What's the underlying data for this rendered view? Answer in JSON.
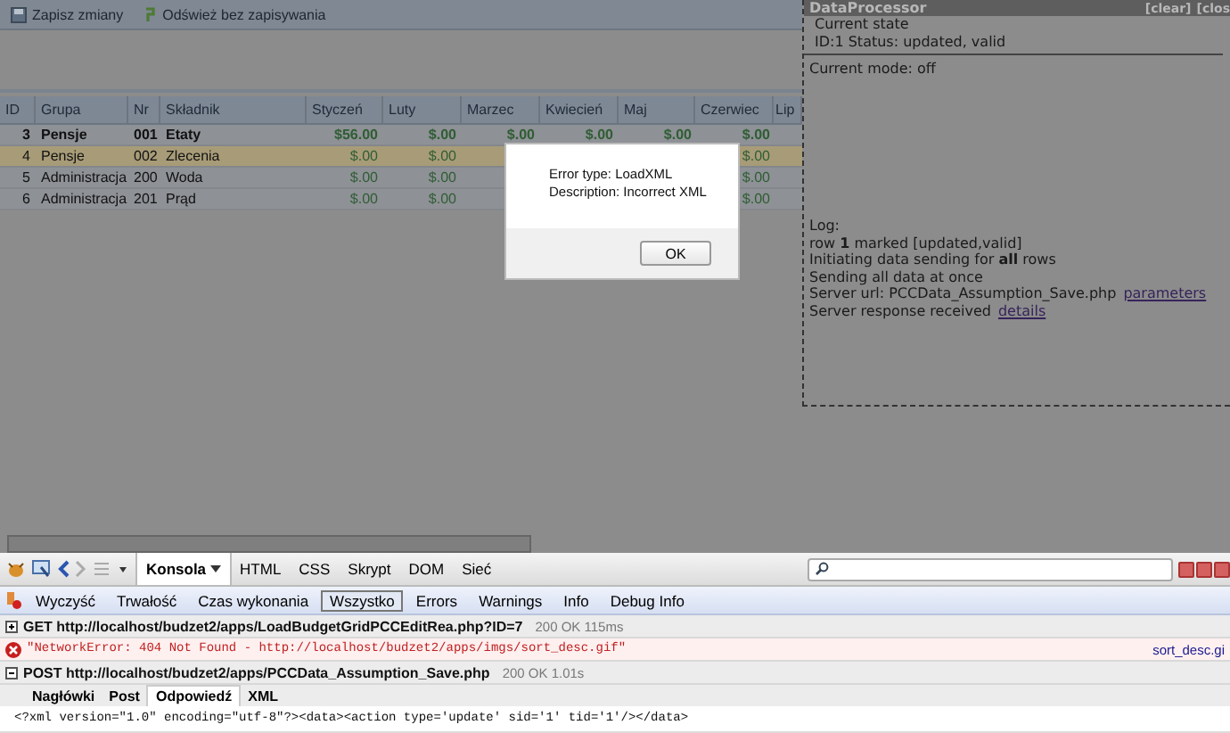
{
  "toolbar": [
    {
      "kind": "save",
      "label": "Zapisz zmiany"
    },
    {
      "kind": "refresh",
      "label": "Odśwież bez zapisywania"
    }
  ],
  "grid": {
    "columns": [
      "ID",
      "Grupa",
      "Nr",
      "Składnik",
      "Styczeń",
      "Luty",
      "Marzec",
      "Kwiecień",
      "Maj",
      "Czerwiec",
      "Lip"
    ],
    "rows": [
      {
        "id": "3",
        "group": "Pensje",
        "nr": "001",
        "name": "Etaty",
        "values": [
          "$56.00",
          "$.00",
          "$.00",
          "$.00",
          "$.00",
          "$.00"
        ],
        "updated": true,
        "selected": false
      },
      {
        "id": "4",
        "group": "Pensje",
        "nr": "002",
        "name": "Zlecenia",
        "values": [
          "$.00",
          "$.00",
          "$.00"
        ],
        "updated": false,
        "selected": true
      },
      {
        "id": "5",
        "group": "Administracja",
        "nr": "200",
        "name": "Woda",
        "values": [
          "$.00",
          "$.00",
          "$.00"
        ],
        "updated": false,
        "selected": false
      },
      {
        "id": "6",
        "group": "Administracja",
        "nr": "201",
        "name": "Prąd",
        "values": [
          "$.00",
          "$.00",
          "$.00"
        ],
        "updated": false,
        "selected": false
      }
    ]
  },
  "dialog": {
    "lines": [
      "Error type: LoadXML",
      "Description: Incorrect XML"
    ],
    "button": "OK"
  },
  "data_processor": {
    "title": "DataProcessor",
    "actions": [
      "[clear]",
      "[clos"
    ],
    "state_lines": [
      "Current state",
      "ID:1 Status: updated, valid"
    ],
    "mode": "Current mode: off",
    "log": [
      {
        "text": "Log:"
      },
      {
        "text": "row **1** marked [updated,valid]"
      },
      {
        "text": "Initiating data sending for **all** rows"
      },
      {
        "text": "Sending all data at once"
      },
      {
        "text": "Server url: PCCData_Assumption_Save.php",
        "link": "parameters"
      },
      {
        "text": "Server response received",
        "link": "details"
      }
    ]
  },
  "firebug": {
    "panels": [
      {
        "label": "Konsola",
        "selected": true
      },
      {
        "label": "HTML",
        "selected": false
      },
      {
        "label": "CSS",
        "selected": false
      },
      {
        "label": "Skrypt",
        "selected": false
      },
      {
        "label": "DOM",
        "selected": false
      },
      {
        "label": "Sieć",
        "selected": false
      }
    ],
    "filters": [
      {
        "label": "Wyczyść",
        "selected": false
      },
      {
        "label": "Trwałość",
        "selected": false
      },
      {
        "label": "Czas wykonania",
        "selected": false
      },
      {
        "label": "Wszystko",
        "selected": true
      },
      {
        "label": "Errors",
        "selected": false
      },
      {
        "label": "Warnings",
        "selected": false
      },
      {
        "label": "Info",
        "selected": false
      },
      {
        "label": "Debug Info",
        "selected": false
      }
    ],
    "entries": [
      {
        "kind": "request",
        "expanded": false,
        "text": "GET http://localhost/budzet2/apps/LoadBudgetGridPCCEditRea.php?ID=7",
        "status": "200 OK 115ms"
      },
      {
        "kind": "error",
        "text": "\"NetworkError: 404 Not Found - http://localhost/budzet2/apps/imgs/sort_desc.gif\"",
        "source": "sort_desc.gi"
      },
      {
        "kind": "request",
        "expanded": true,
        "text": "POST http://localhost/budzet2/apps/PCCData_Assumption_Save.php",
        "status": "200 OK 1.01s"
      }
    ],
    "response_tabs": [
      {
        "label": "Nagłówki",
        "selected": false
      },
      {
        "label": "Post",
        "selected": false
      },
      {
        "label": "Odpowiedź",
        "selected": true
      },
      {
        "label": "XML",
        "selected": false
      }
    ],
    "response": "<?xml version=\"1.0\" encoding=\"utf-8\"?><data><action type='update' sid='1' tid='1'/></data>"
  }
}
